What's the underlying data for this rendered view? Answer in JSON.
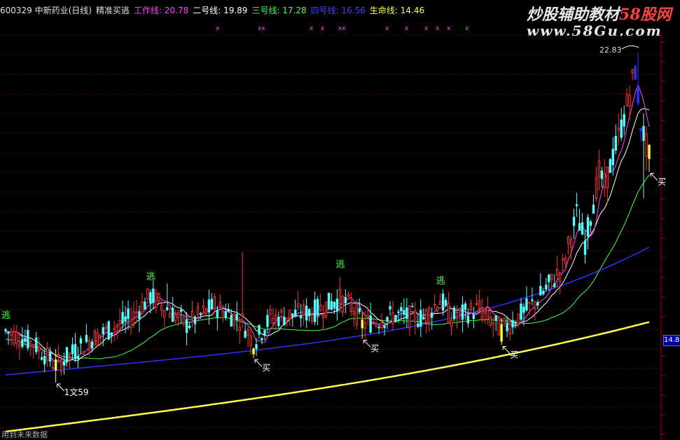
{
  "header": {
    "code_name": "600329 中新药业(日线)",
    "indicator": "精准买逃",
    "line1_label": "工作线: 20.78",
    "line2_label": "二号线: 19.89",
    "line3_label": "三号线: 17.28",
    "line4_label": "四号线: 16.56",
    "line5_label": "生命线: 14.46"
  },
  "watermark": {
    "line1_text": "炒股辅助教材",
    "line1_red": "58股网",
    "line2": "www.58Gu.com"
  },
  "price_tag": "14.8",
  "footer": "用到未来数据",
  "colors": {
    "up": "#ff3030",
    "down": "#54ffff",
    "work_line": "#ff40ff",
    "line2": "#ffffff",
    "line3": "#40ff40",
    "line4": "#3030ff",
    "life_line": "#ffff50",
    "grid": "#700000",
    "buy_bar": "#ffff40",
    "escape_text": "#40ff40"
  },
  "chart_data": {
    "type": "candlestick",
    "title": "600329 中新药业(日线)",
    "peak_label": "22.83",
    "low_label": "1文59",
    "signal_escape": "逃",
    "signal_buy": "买",
    "escape_signals": [
      {
        "index": 0,
        "label": "逃"
      },
      {
        "index": 52,
        "label": "逃"
      },
      {
        "index": 120,
        "label": "逃"
      },
      {
        "index": 156,
        "label": "逃"
      }
    ],
    "buy_signals": [
      {
        "index": 18,
        "label": "1文59"
      },
      {
        "index": 89,
        "label": "买"
      },
      {
        "index": 128,
        "label": "买"
      },
      {
        "index": 178,
        "label": "买"
      },
      {
        "index": 231,
        "label": "买"
      }
    ],
    "x_markers": [
      "x",
      "xx",
      "x",
      "x",
      "xx",
      "x",
      "x",
      "x",
      "x",
      "x",
      "x"
    ],
    "ylim": [
      10.6,
      23.5
    ],
    "ohlc_count": 232
  }
}
